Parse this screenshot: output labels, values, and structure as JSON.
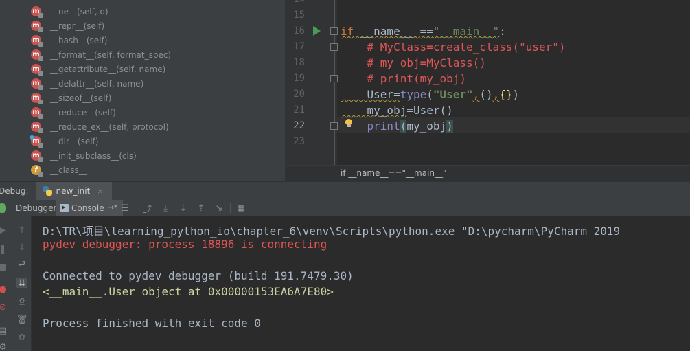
{
  "structure": {
    "items": [
      {
        "label": "__ne__(self, o)",
        "badge": "m"
      },
      {
        "label": "__repr__(self)",
        "badge": "m"
      },
      {
        "label": "__hash__(self)",
        "badge": "m"
      },
      {
        "label": "__format__(self, format_spec)",
        "badge": "m"
      },
      {
        "label": "__getattribute__(self, name)",
        "badge": "m"
      },
      {
        "label": "__delattr__(self, name)",
        "badge": "m"
      },
      {
        "label": "__sizeof__(self)",
        "badge": "m"
      },
      {
        "label": "__reduce__(self)",
        "badge": "m"
      },
      {
        "label": "__reduce_ex__(self, protocol)",
        "badge": "m"
      },
      {
        "label": "__dir__(self)",
        "badge": "m"
      },
      {
        "label": "__init_subclass__(cls)",
        "badge": "m"
      },
      {
        "label": "__class__",
        "badge": "f"
      }
    ]
  },
  "editor": {
    "line_numbers": [
      "14",
      "15",
      "16",
      "17",
      "18",
      "19",
      "20",
      "21",
      "22",
      "23"
    ],
    "current_line": "22",
    "code": {
      "l16_kw": "if",
      "l16_name": " __name__ ",
      "l16_op": "==",
      "l16_str": "\"__main__\"",
      "l16_colon": ":",
      "l17": "    # MyClass=create_class(\"user\")",
      "l18": "    # my_obj=MyClass()",
      "l19": "    # print(my_obj)",
      "l20_a": "    User",
      "l20_b": "=",
      "l20_c": "type",
      "l20_d": "(",
      "l20_e": "\"User\"",
      "l20_f": ",",
      "l20_g": "()",
      "l20_h": ",",
      "l20_i": "{}",
      "l20_j": ")",
      "l21_a": "    my_obj",
      "l21_b": "=",
      "l21_c": "User()",
      "l22_a": "    print",
      "l22_b": "(",
      "l22_c": "my_obj",
      "l22_d": ")"
    },
    "breadcrumb": "if __name__==\"__main__\""
  },
  "debug": {
    "label": "Debug:",
    "session_tab": "new_init",
    "tab_close": "×",
    "tabs": {
      "debugger": "Debugger",
      "console": "Console"
    },
    "console_pin": "→*"
  },
  "console": {
    "lines": [
      {
        "text": "D:\\TR\\项目\\learning_python_io\\chapter_6\\venv\\Scripts\\python.exe \"D:\\pycharm\\PyCharm 2019",
        "kind": "cmd"
      },
      {
        "text": "pydev debugger: process 18896 is connecting",
        "kind": "err"
      },
      {
        "text": "Connected to pydev debugger (build 191.7479.30)",
        "kind": "cmd"
      },
      {
        "text": "<__main__.User object at 0x00000153EA6A7E80>",
        "kind": "out"
      },
      {
        "text": "Process finished with exit code 0",
        "kind": "cmd"
      }
    ]
  },
  "colors": {
    "keyword": "#cc7832",
    "string": "#6a8759",
    "comment": "#e05555",
    "builtin": "#8888c6",
    "text": "#a9b7c6",
    "error": "#e05555"
  }
}
